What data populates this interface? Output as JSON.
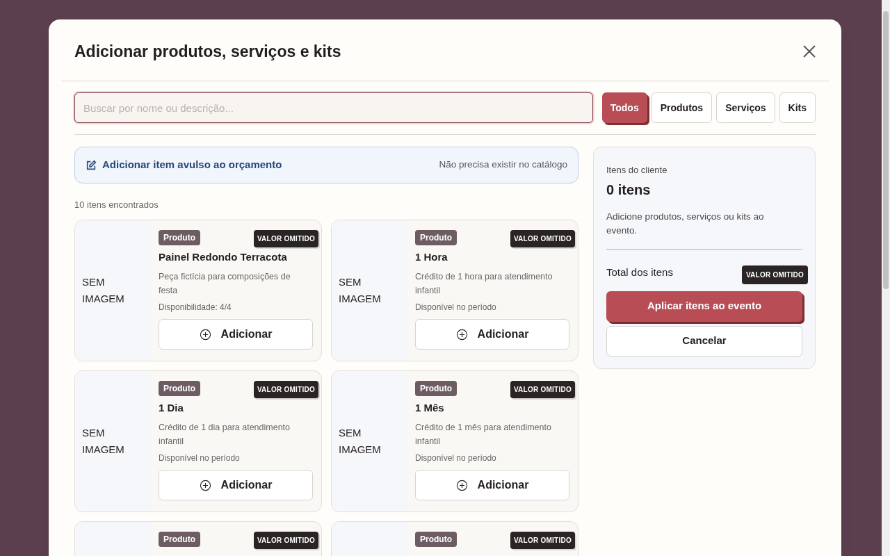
{
  "dialog": {
    "title": "Adicionar produtos, serviços e kits"
  },
  "search": {
    "placeholder": "Buscar por nome ou descrição..."
  },
  "filters": [
    {
      "label": "Todos",
      "selected": true
    },
    {
      "label": "Produtos",
      "selected": false
    },
    {
      "label": "Serviços",
      "selected": false
    },
    {
      "label": "Kits",
      "selected": false
    }
  ],
  "custom_item": {
    "label": "Adicionar item avulso ao orçamento",
    "hint": "Não precisa existir no catálogo"
  },
  "results_count": "10 itens encontrados",
  "items": [
    {
      "image": "SEM IMAGEM",
      "type": "Produto",
      "price": "VALOR OMITIDO",
      "name": "Painel Redondo Terracota",
      "description": "Peça fictícia para composições de festa",
      "availability": "Disponibilidade: 4/4",
      "button": "Adicionar"
    },
    {
      "image": "SEM IMAGEM",
      "type": "Produto",
      "price": "VALOR OMITIDO",
      "name": "1 Hora",
      "description": "Crédito de 1 hora para atendimento infantil",
      "availability": "Disponível no período",
      "button": "Adicionar"
    },
    {
      "image": "SEM IMAGEM",
      "type": "Produto",
      "price": "VALOR OMITIDO",
      "name": "1 Dia",
      "description": "Crédito de 1 dia para atendimento infantil",
      "availability": "Disponível no período",
      "button": "Adicionar"
    },
    {
      "image": "SEM IMAGEM",
      "type": "Produto",
      "price": "VALOR OMITIDO",
      "name": "1 Mês",
      "description": "Crédito de 1 mês para atendimento infantil",
      "availability": "Disponível no período",
      "button": "Adicionar"
    },
    {
      "type": "Produto",
      "price": "VALOR OMITIDO"
    },
    {
      "type": "Produto",
      "price": "VALOR OMITIDO"
    }
  ],
  "summary": {
    "label": "Itens do cliente",
    "count": "0 itens",
    "hint": "Adicione produtos, serviços ou kits ao evento.",
    "total_label": "Total dos itens",
    "total": "VALOR OMITIDO",
    "apply_button": "Aplicar itens ao evento",
    "cancel_button": "Cancelar"
  }
}
